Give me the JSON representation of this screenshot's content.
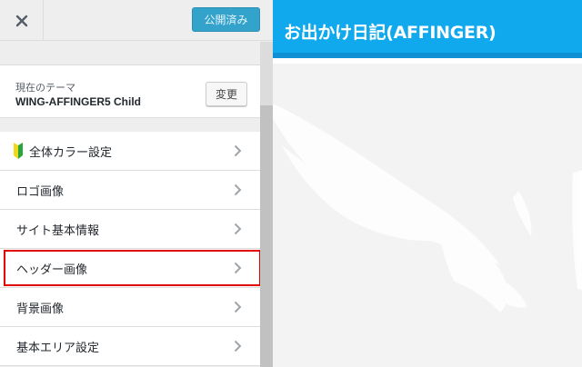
{
  "toolbar": {
    "close_icon": "close-icon",
    "publish_label": "公開済み"
  },
  "theme": {
    "label": "現在のテーマ",
    "name": "WING-AFFINGER5 Child",
    "change_label": "変更"
  },
  "menu": {
    "items": [
      {
        "label": "全体カラー設定",
        "icon": "beginner-mark-icon"
      },
      {
        "label": "ロゴ画像"
      },
      {
        "label": "サイト基本情報"
      },
      {
        "label": "ヘッダー画像",
        "highlighted": true
      },
      {
        "label": "背景画像"
      },
      {
        "label": "基本エリア設定"
      }
    ]
  },
  "preview": {
    "site_title": "お出かけ日記(AFFINGER)"
  },
  "colors": {
    "publish_bg": "#33a3cc",
    "header_bg": "#11a9ed",
    "highlight_border": "#e00000"
  }
}
